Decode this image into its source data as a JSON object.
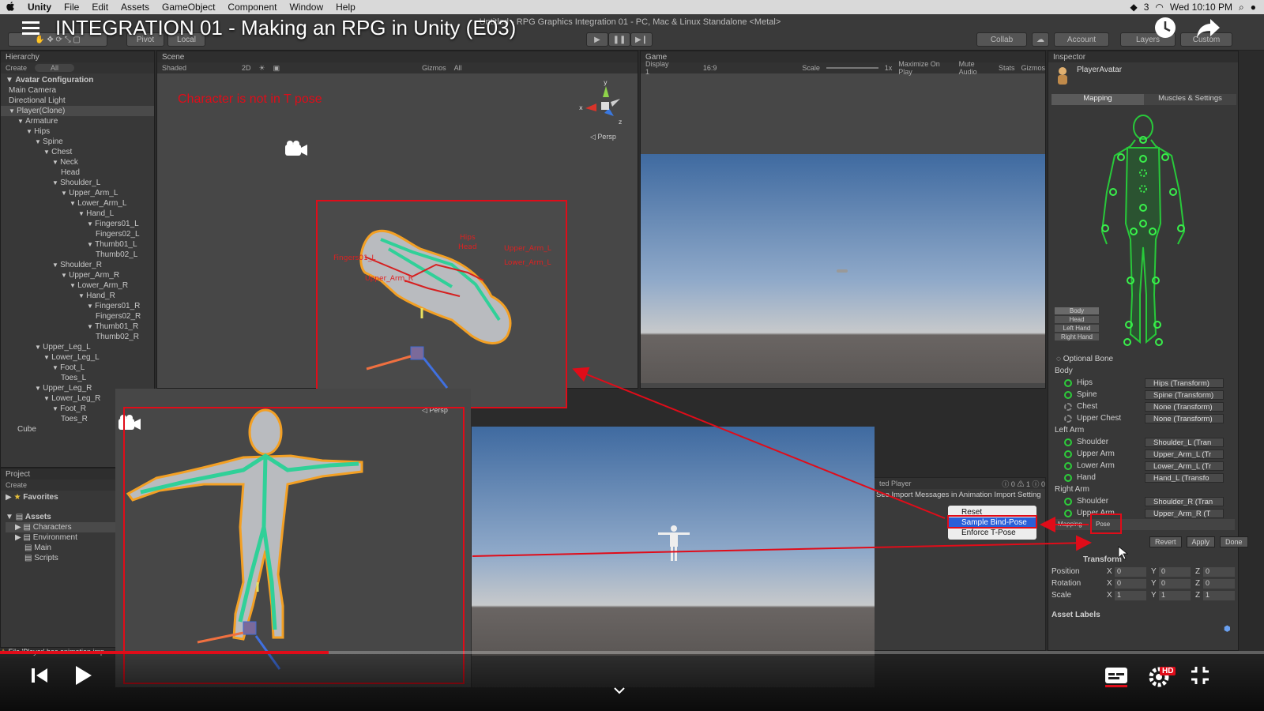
{
  "mac_menubar": {
    "apple": "",
    "app": "Unity",
    "items": [
      "File",
      "Edit",
      "Assets",
      "GameObject",
      "Component",
      "Window",
      "Help"
    ],
    "status_text": "Wed 10:10 PM",
    "status_count": "3"
  },
  "video": {
    "title": "INTEGRATION 01 - Making an RPG in Unity (E03)"
  },
  "window_title": "- Untitled - RPG Graphics Integration 01 - PC, Mac & Linux Standalone <Metal>",
  "toolbar": {
    "pivot": "Pivot",
    "local": "Local",
    "collab": "Collab",
    "account": "Account",
    "layers": "Layers",
    "custom": "Custom"
  },
  "hierarchy": {
    "tab": "Hierarchy",
    "create": "Create",
    "search": "All",
    "root": "Avatar Configuration",
    "items": [
      {
        "label": "Main Camera",
        "indent": 0
      },
      {
        "label": "Directional Light",
        "indent": 0
      },
      {
        "label": "Player(Clone)",
        "indent": 0,
        "arrow": true,
        "selected": true
      },
      {
        "label": "Armature",
        "indent": 1,
        "arrow": true
      },
      {
        "label": "Hips",
        "indent": 2,
        "arrow": true
      },
      {
        "label": "Spine",
        "indent": 3,
        "arrow": true
      },
      {
        "label": "Chest",
        "indent": 4,
        "arrow": true
      },
      {
        "label": "Neck",
        "indent": 5,
        "arrow": true
      },
      {
        "label": "Head",
        "indent": 6
      },
      {
        "label": "Shoulder_L",
        "indent": 5,
        "arrow": true
      },
      {
        "label": "Upper_Arm_L",
        "indent": 6,
        "arrow": true
      },
      {
        "label": "Lower_Arm_L",
        "indent": 7,
        "arrow": true
      },
      {
        "label": "Hand_L",
        "indent": 8,
        "arrow": true
      },
      {
        "label": "Fingers01_L",
        "indent": 9,
        "arrow": true
      },
      {
        "label": "Fingers02_L",
        "indent": 10
      },
      {
        "label": "Thumb01_L",
        "indent": 9,
        "arrow": true
      },
      {
        "label": "Thumb02_L",
        "indent": 10
      },
      {
        "label": "Shoulder_R",
        "indent": 5,
        "arrow": true
      },
      {
        "label": "Upper_Arm_R",
        "indent": 6,
        "arrow": true
      },
      {
        "label": "Lower_Arm_R",
        "indent": 7,
        "arrow": true
      },
      {
        "label": "Hand_R",
        "indent": 8,
        "arrow": true
      },
      {
        "label": "Fingers01_R",
        "indent": 9,
        "arrow": true
      },
      {
        "label": "Fingers02_R",
        "indent": 10
      },
      {
        "label": "Thumb01_R",
        "indent": 9,
        "arrow": true
      },
      {
        "label": "Thumb02_R",
        "indent": 10
      },
      {
        "label": "Upper_Leg_L",
        "indent": 3,
        "arrow": true
      },
      {
        "label": "Lower_Leg_L",
        "indent": 4,
        "arrow": true
      },
      {
        "label": "Foot_L",
        "indent": 5,
        "arrow": true
      },
      {
        "label": "Toes_L",
        "indent": 6
      },
      {
        "label": "Upper_Leg_R",
        "indent": 3,
        "arrow": true
      },
      {
        "label": "Lower_Leg_R",
        "indent": 4,
        "arrow": true
      },
      {
        "label": "Foot_R",
        "indent": 5,
        "arrow": true
      },
      {
        "label": "Toes_R",
        "indent": 6
      },
      {
        "label": "Cube",
        "indent": 1
      }
    ]
  },
  "scene": {
    "tab": "Scene",
    "shaded": "Shaded",
    "mode_2d": "2D",
    "gizmos": "Gizmos",
    "search": "All",
    "warning": "Character is not in T pose",
    "persp": "Persp",
    "persp2": "Persp",
    "axis_x": "x",
    "axis_y": "y",
    "axis_z": "z"
  },
  "game": {
    "tab": "Game",
    "display": "Display 1",
    "aspect": "16:9",
    "scale_label": "Scale",
    "scale_value": "1x",
    "maximize": "Maximize On Play",
    "mute": "Mute Audio",
    "stats": "Stats",
    "gizmos": "Gizmos"
  },
  "project": {
    "tab": "Project",
    "create": "Create",
    "favorites": "Favorites",
    "assets": "Assets",
    "folders": [
      "Characters",
      "Environment",
      "Main",
      "Scripts"
    ]
  },
  "console": {
    "warning": "File 'Player' has animation imp"
  },
  "inspector": {
    "tab": "Inspector",
    "object": "PlayerAvatar",
    "tab_mapping": "Mapping",
    "tab_muscles": "Muscles & Settings",
    "body_buttons": [
      "Body",
      "Head",
      "Left Hand",
      "Right Hand"
    ],
    "optional_bone": "Optional Bone",
    "groups": [
      {
        "title": "Body",
        "rows": [
          {
            "label": "Hips",
            "value": "Hips (Transform)",
            "mapped": true
          },
          {
            "label": "Spine",
            "value": "Spine (Transform)",
            "mapped": true
          },
          {
            "label": "Chest",
            "value": "None (Transform)",
            "mapped": false
          },
          {
            "label": "Upper Chest",
            "value": "None (Transform)",
            "mapped": false
          }
        ]
      },
      {
        "title": "Left Arm",
        "rows": [
          {
            "label": "Shoulder",
            "value": "Shoulder_L (Tran",
            "mapped": true
          },
          {
            "label": "Upper Arm",
            "value": "Upper_Arm_L (Tr",
            "mapped": true
          },
          {
            "label": "Lower Arm",
            "value": "Lower_Arm_L (Tr",
            "mapped": true
          },
          {
            "label": "Hand",
            "value": "Hand_L (Transfo",
            "mapped": true
          }
        ]
      },
      {
        "title": "Right Arm",
        "rows": [
          {
            "label": "Shoulder",
            "value": "Shoulder_R (Tran",
            "mapped": true
          },
          {
            "label": "Upper Arm",
            "value": "Upper_Arm_R (T",
            "mapped": true
          }
        ]
      }
    ],
    "mapping_dropdown": "Mapping",
    "pose_dropdown": "Pose",
    "revert": "Revert",
    "apply": "Apply",
    "done": "Done",
    "transform": {
      "title": "Transform",
      "rows": [
        {
          "label": "Position",
          "x": "0",
          "y": "0",
          "z": "0"
        },
        {
          "label": "Rotation",
          "x": "0",
          "y": "0",
          "z": "0"
        },
        {
          "label": "Scale",
          "x": "1",
          "y": "1",
          "z": "1"
        }
      ]
    },
    "asset_labels": "Asset Labels"
  },
  "import_strip": {
    "player_label": "ted Player",
    "message": "See Import Messages in Animation Import Setting",
    "counts": [
      "0",
      "1",
      "0"
    ]
  },
  "pose_menu": {
    "items": [
      "Reset",
      "Sample Bind-Pose",
      "Enforce T-Pose"
    ],
    "highlighted": "Sample Bind-Pose"
  },
  "bone_labels": [
    "Hips",
    "Upper_Arm_L",
    "Lower_Arm_L",
    "Fingers01_L",
    "Head",
    "Upper_Arm_R"
  ],
  "youtube": {
    "hd_badge": "HD",
    "progress_pct": 26
  },
  "colors": {
    "unity_bg": "#383838",
    "red_annotation": "#e00c19",
    "bone_green": "#2dcc3a",
    "selection_blue": "#2a5fd8",
    "outline_orange": "#f3a024"
  }
}
